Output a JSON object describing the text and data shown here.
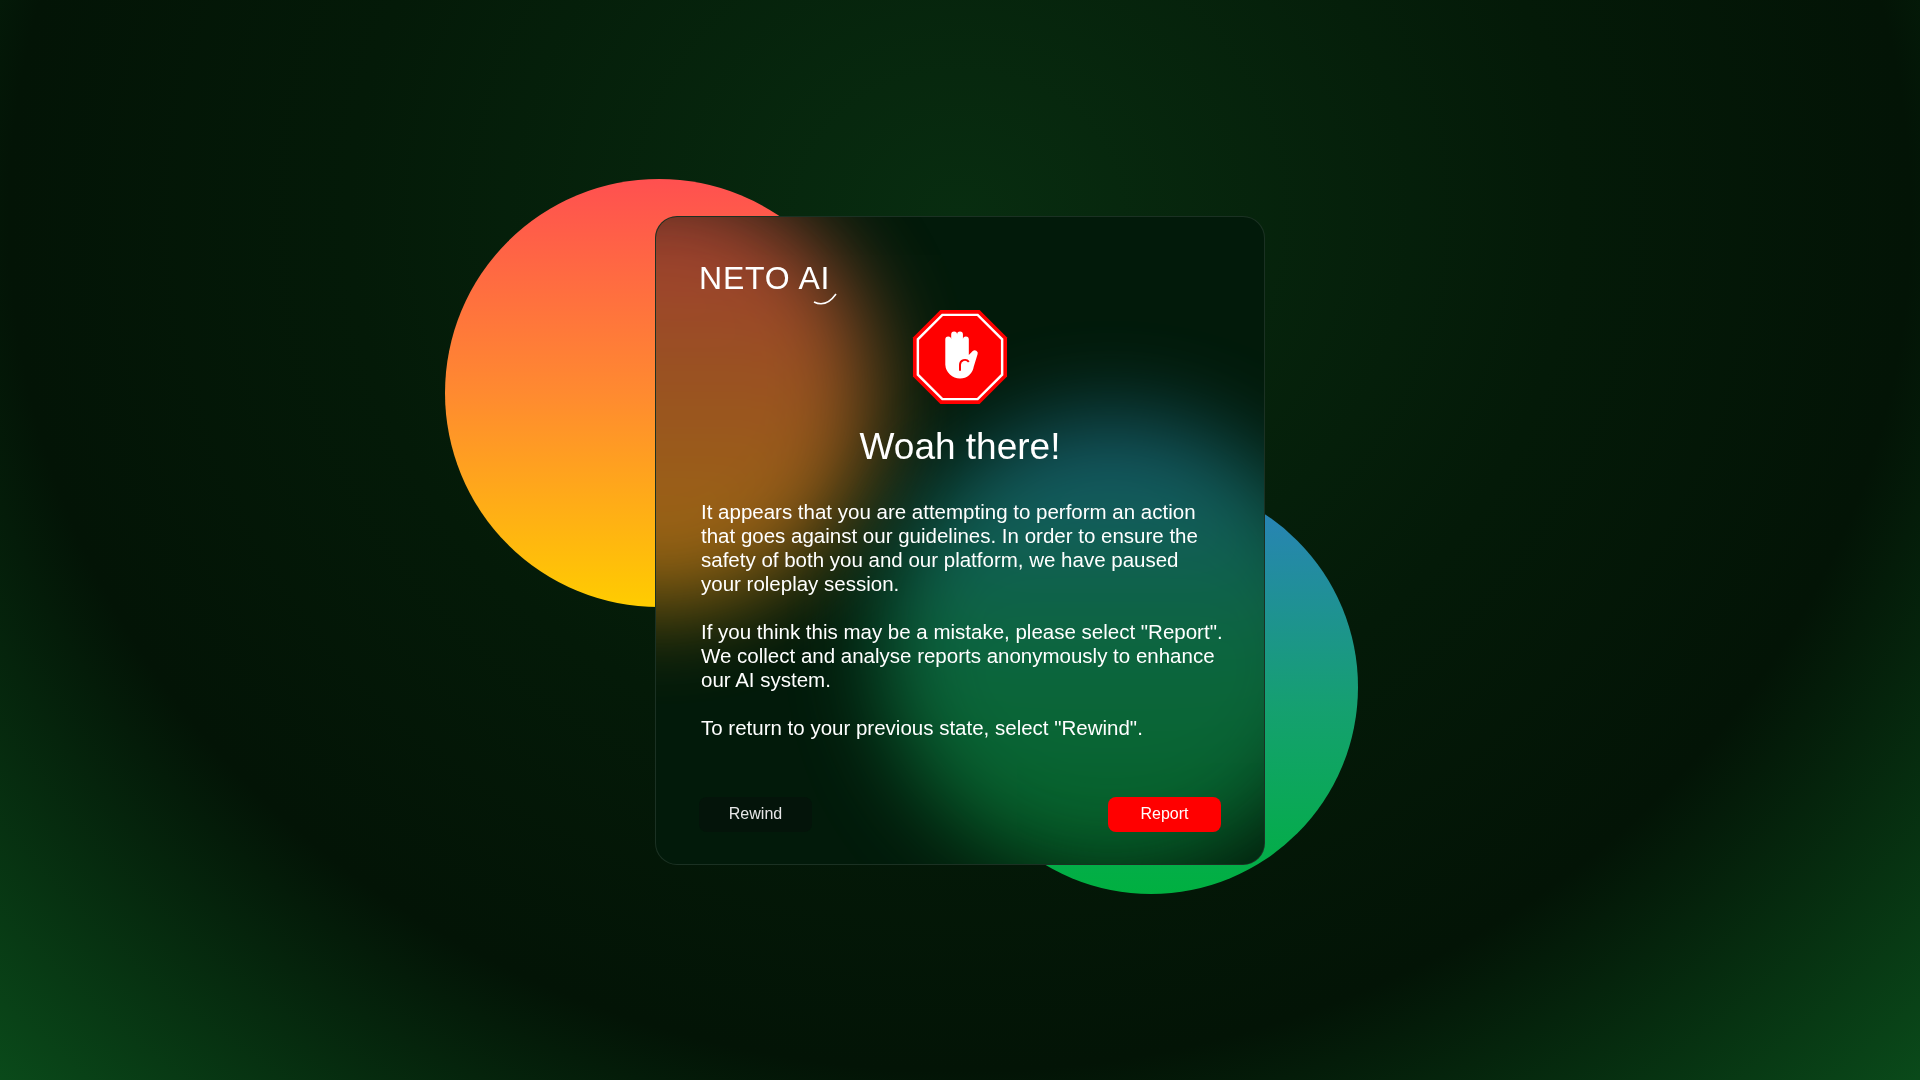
{
  "logo": {
    "text": "NETO AI"
  },
  "dialog": {
    "title": "Woah there!",
    "paragraphs": [
      "It appears that you are attempting to perform an action that goes against our guidelines. In order to ensure the safety of both you and our platform, we have paused your roleplay session.",
      "If you think this may be a mistake, please select \"Report\". We collect and analyse reports anonymously to enhance our AI system.",
      "To return to your previous state, select \"Rewind\"."
    ],
    "buttons": [
      {
        "label": "Rewind",
        "kind": "secondary"
      },
      {
        "label": "Report",
        "kind": "danger"
      }
    ]
  }
}
